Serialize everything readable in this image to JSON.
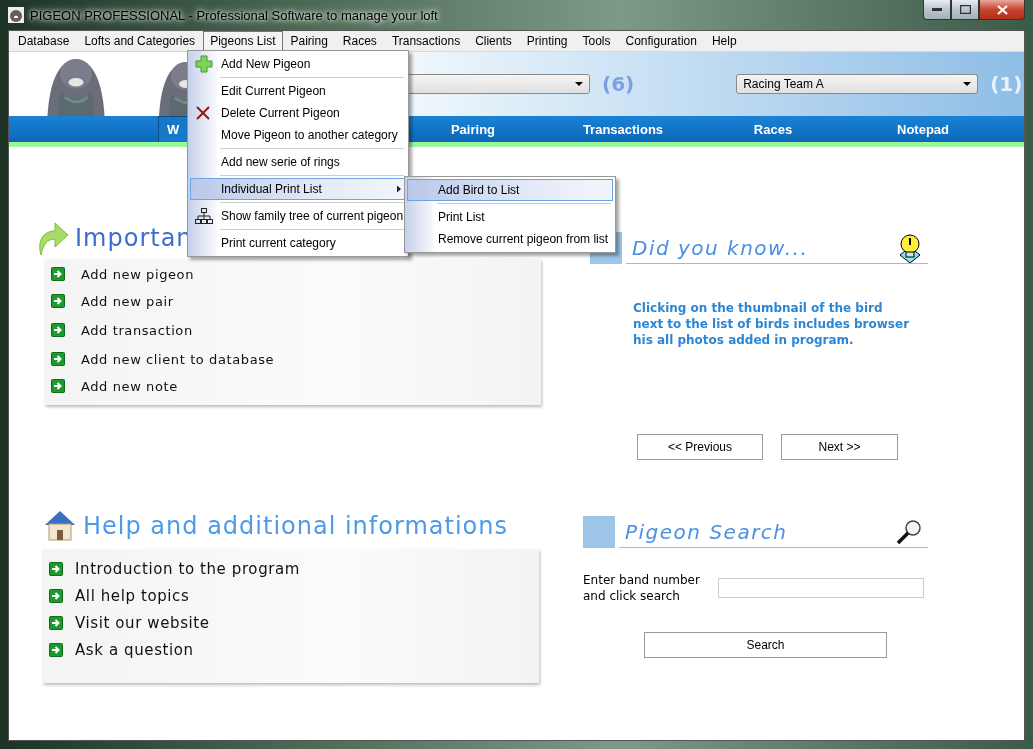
{
  "window": {
    "title": "PIGEON PROFESSIONAL - Professional Software to manage your loft"
  },
  "menu_bar": [
    {
      "label": "Database",
      "selected": false
    },
    {
      "label": "Lofts and Categories",
      "selected": false
    },
    {
      "label": "Pigeons List",
      "selected": true
    },
    {
      "label": "Pairing",
      "selected": false
    },
    {
      "label": "Races",
      "selected": false
    },
    {
      "label": "Transactions",
      "selected": false
    },
    {
      "label": "Clients",
      "selected": false
    },
    {
      "label": "Printing",
      "selected": false
    },
    {
      "label": "Tools",
      "selected": false
    },
    {
      "label": "Configuration",
      "selected": false
    },
    {
      "label": "Help",
      "selected": false
    }
  ],
  "header": {
    "combo_1": {
      "count": "(6)"
    },
    "combo_2": {
      "value": "Racing Team A",
      "count": "(1)"
    }
  },
  "nav_tabs": [
    {
      "label": "W",
      "selected": true
    },
    {
      "label": "Pairing",
      "selected": false
    },
    {
      "label": "Transactions",
      "selected": false
    },
    {
      "label": "Races",
      "selected": false
    },
    {
      "label": "Notepad",
      "selected": false
    }
  ],
  "important": {
    "title": "Importan",
    "links": [
      "Add new pigeon",
      "Add new pair",
      "Add transaction",
      "Add new client to database",
      "Add new note"
    ]
  },
  "help": {
    "title": "Help and additional informations",
    "links": [
      "Introduction to the program",
      "All help topics",
      "Visit our website",
      "Ask a question"
    ]
  },
  "did_you_know": {
    "title": "Did you know...",
    "text": "Clicking on the thumbnail of the bird next to the list of birds includes browser his all photos added in program.",
    "buttons": [
      "<< Previous",
      "Next >>"
    ]
  },
  "pigeon_search": {
    "title": "Pigeon Search",
    "label": "Enter band number and click search",
    "button": "Search"
  },
  "dropdown_menu": [
    {
      "label": "Add New Pigeon",
      "selected": false,
      "divider_above": false,
      "submenu": false
    },
    {
      "label": "Edit Current Pigeon",
      "selected": false,
      "divider_above": true,
      "submenu": false
    },
    {
      "label": "Delete Current Pigeon",
      "selected": false,
      "divider_above": false,
      "submenu": false
    },
    {
      "label": "Move Pigeon to another category",
      "selected": false,
      "divider_above": false,
      "submenu": false
    },
    {
      "label": "Add new serie of rings",
      "selected": false,
      "divider_above": true,
      "submenu": false
    },
    {
      "label": "Individual Print List",
      "selected": true,
      "divider_above": true,
      "submenu": true
    },
    {
      "label": "Show family tree of current pigeon",
      "selected": false,
      "divider_above": true,
      "submenu": false
    },
    {
      "label": "Print current category",
      "selected": false,
      "divider_above": true,
      "submenu": false
    }
  ],
  "submenu": [
    {
      "label": "Add Bird to List",
      "selected": true,
      "divider_above": false
    },
    {
      "label": "Print List",
      "selected": false,
      "divider_above": true
    },
    {
      "label": "Remove current pigeon from list",
      "selected": false,
      "divider_above": false
    }
  ]
}
